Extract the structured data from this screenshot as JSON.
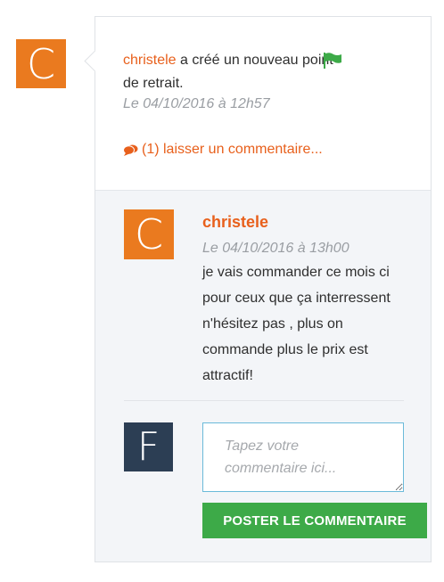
{
  "activity": {
    "avatar_letter": "C",
    "author": "christele",
    "action": "a créé un nouveau point de retrait.",
    "timestamp": "Le 04/10/2016 à 12h57",
    "comment_link": "(1) laisser un commentaire...",
    "icons": {
      "flag": "flag-icon",
      "comments": "comments-icon"
    },
    "colors": {
      "accent": "#e8601c",
      "flag": "#3daa48",
      "avatar": "#ea7a1f"
    }
  },
  "comment": {
    "avatar_letter": "C",
    "author": "christele",
    "timestamp": "Le 04/10/2016 à 13h00",
    "text": "je vais commander ce mois ci pour ceux que ça interressent n'hésitez pas , plus on commande plus le prix est attractif!"
  },
  "reply": {
    "avatar_letter": "F",
    "placeholder": "Tapez votre commentaire ici...",
    "value": "",
    "submit_label": "POSTER LE COMMENTAIRE",
    "colors": {
      "avatar": "#2c3e54",
      "button": "#3daa48"
    }
  }
}
